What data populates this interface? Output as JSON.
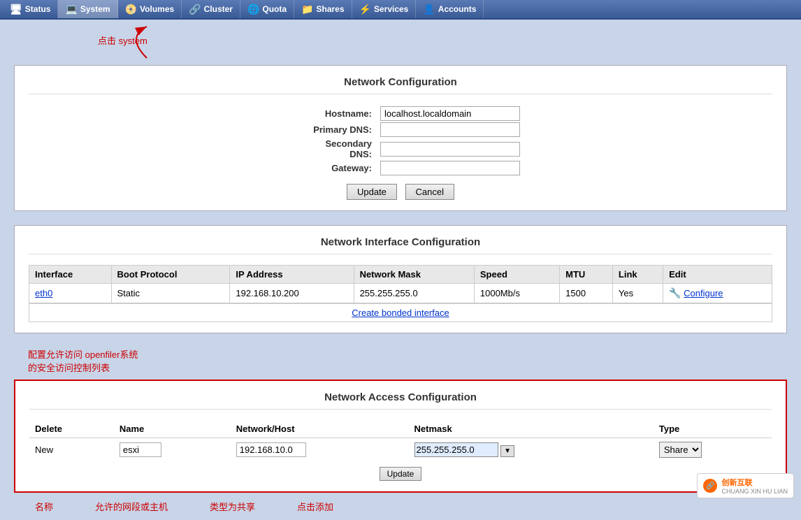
{
  "navbar": {
    "tabs": [
      {
        "id": "status",
        "label": "Status",
        "icon": "🖥",
        "active": false
      },
      {
        "id": "system",
        "label": "System",
        "icon": "💻",
        "active": true
      },
      {
        "id": "volumes",
        "label": "Volumes",
        "icon": "📀",
        "active": false
      },
      {
        "id": "cluster",
        "label": "Cluster",
        "icon": "🔗",
        "active": false
      },
      {
        "id": "quota",
        "label": "Quota",
        "icon": "🌐",
        "active": false
      },
      {
        "id": "shares",
        "label": "Shares",
        "icon": "📁",
        "active": false
      },
      {
        "id": "services",
        "label": "Services",
        "icon": "⚡",
        "active": false
      },
      {
        "id": "accounts",
        "label": "Accounts",
        "icon": "👤",
        "active": false
      }
    ]
  },
  "annotation": {
    "click_system": "点击 system"
  },
  "network_config": {
    "title": "Network Configuration",
    "fields": {
      "hostname": {
        "label": "Hostname:",
        "value": "localhost.localdomain",
        "placeholder": ""
      },
      "primary_dns": {
        "label": "Primary DNS:",
        "value": "",
        "placeholder": ""
      },
      "secondary_dns": {
        "label": "Secondary DNS:",
        "value": "",
        "placeholder": ""
      },
      "gateway": {
        "label": "Gateway:",
        "value": "",
        "placeholder": ""
      }
    },
    "buttons": {
      "update": "Update",
      "cancel": "Cancel"
    }
  },
  "network_interface": {
    "title": "Network Interface Configuration",
    "columns": [
      "Interface",
      "Boot Protocol",
      "IP Address",
      "Network Mask",
      "Speed",
      "MTU",
      "Link",
      "Edit"
    ],
    "rows": [
      {
        "interface": "eth0",
        "boot_protocol": "Static",
        "ip_address": "192.168.10.200",
        "network_mask": "255.255.255.0",
        "speed": "1000Mb/s",
        "mtu": "1500",
        "link": "Yes",
        "edit": "Configure"
      }
    ],
    "create_link": "Create bonded interface"
  },
  "annotation2": {
    "text": "配置允许访问 openfiler系统\n的安全访问控制列表"
  },
  "network_access": {
    "title": "Network Access Configuration",
    "columns": [
      "Delete",
      "Name",
      "Network/Host",
      "Netmask",
      "Type"
    ],
    "row": {
      "delete_label": "New",
      "name_value": "esxi",
      "network_value": "192.168.10.0",
      "netmask_value": "255.255.255.0",
      "type_value": "Share"
    },
    "update_btn": "Update"
  },
  "bottom_annotations": {
    "name_label": "名称",
    "network_label": "允许的网段或主机",
    "type_label": "类型为共享",
    "update_label": "点击添加"
  },
  "watermark": {
    "text": "创新互联",
    "sub": "CHUANG XIN HU LIAN"
  }
}
